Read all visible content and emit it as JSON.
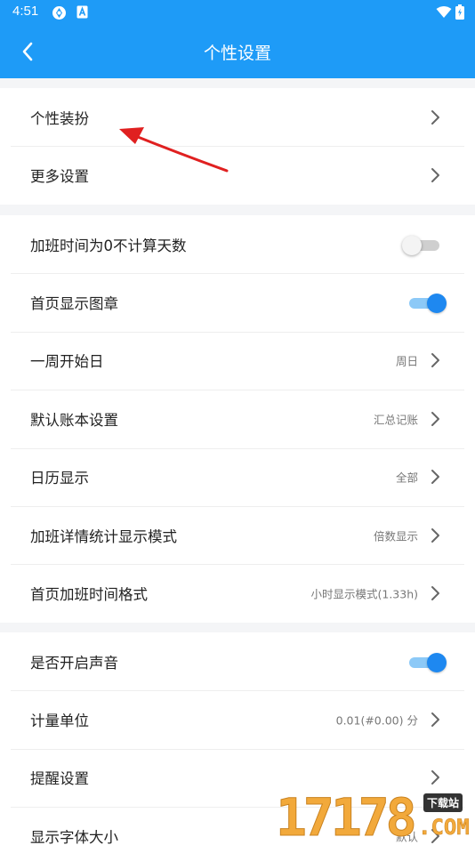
{
  "status_bar": {
    "time": "4:51",
    "icons": [
      "sync-icon",
      "notification-a-icon",
      "wifi-icon",
      "battery-icon"
    ]
  },
  "header": {
    "title": "个性设置",
    "back_icon": "chevron-left-icon",
    "background": "#1e9bf7"
  },
  "groups": [
    {
      "items": [
        {
          "label": "个性装扮",
          "type": "nav"
        },
        {
          "label": "更多设置",
          "type": "nav"
        }
      ]
    },
    {
      "items": [
        {
          "label": "加班时间为0不计算天数",
          "type": "toggle",
          "checked": false
        },
        {
          "label": "首页显示图章",
          "type": "toggle",
          "checked": true
        },
        {
          "label": "一周开始日",
          "type": "nav",
          "value": "周日"
        },
        {
          "label": "默认账本设置",
          "type": "nav",
          "value": "汇总记账"
        },
        {
          "label": "日历显示",
          "type": "nav",
          "value": "全部"
        },
        {
          "label": "加班详情统计显示模式",
          "type": "nav",
          "value": "倍数显示"
        },
        {
          "label": "首页加班时间格式",
          "type": "nav",
          "value": "小时显示模式(1.33h)"
        }
      ]
    },
    {
      "items": [
        {
          "label": "是否开启声音",
          "type": "toggle",
          "checked": true
        },
        {
          "label": "计量单位",
          "type": "nav",
          "value": "0.01(#0.00) 分"
        },
        {
          "label": "提醒设置",
          "type": "nav"
        },
        {
          "label": "显示字体大小",
          "type": "nav",
          "value": "默认"
        }
      ]
    }
  ],
  "annotation": {
    "type": "red-arrow",
    "color": "#e02020"
  },
  "watermark": {
    "digits": "17178",
    "tag": "下载站",
    "suffix": ".COM"
  },
  "colors": {
    "accent": "#1e88f0",
    "arrow": "#e02020"
  }
}
